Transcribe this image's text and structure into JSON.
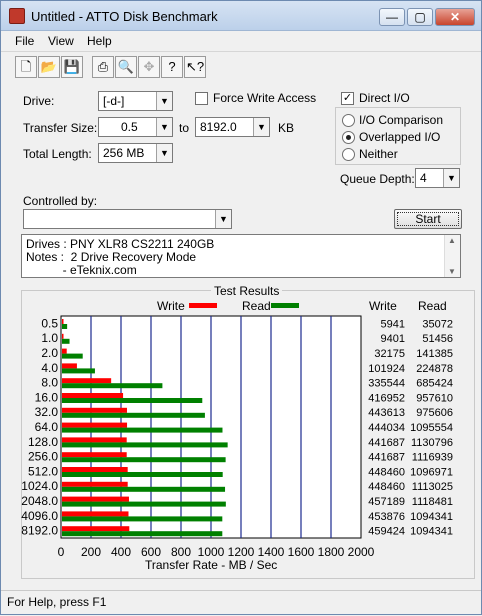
{
  "window": {
    "title": "Untitled - ATTO Disk Benchmark"
  },
  "menu": [
    "File",
    "View",
    "Help"
  ],
  "settings": {
    "drive_label": "Drive:",
    "drive_value": "[-d-]",
    "force_write_label": "Force Write Access",
    "force_write_checked": false,
    "direct_io_label": "Direct I/O",
    "direct_io_checked": true,
    "transfer_size_label": "Transfer Size:",
    "transfer_from": "0.5",
    "to_label": "to",
    "transfer_to": "8192.0",
    "kb_label": "KB",
    "total_length_label": "Total Length:",
    "total_length_value": "256 MB",
    "io_options": [
      "I/O Comparison",
      "Overlapped I/O",
      "Neither"
    ],
    "io_selected": 1,
    "queue_depth_label": "Queue Depth:",
    "queue_depth_value": "4",
    "controlled_by_label": "Controlled by:",
    "controlled_by_value": "",
    "start_label": "Start"
  },
  "notes": {
    "line1": "Drives : PNY XLR8 CS2211 240GB",
    "line2": "Notes :  2 Drive Recovery Mode",
    "line3": "           - eTeknix.com"
  },
  "results": {
    "title": "Test Results",
    "legend_write": "Write",
    "legend_read": "Read",
    "col_write": "Write",
    "col_read": "Read",
    "colors": {
      "write": "#ff0000",
      "read": "#008000"
    }
  },
  "chart_data": {
    "type": "bar",
    "orientation": "horizontal",
    "categories": [
      "0.5",
      "1.0",
      "2.0",
      "4.0",
      "8.0",
      "16.0",
      "32.0",
      "64.0",
      "128.0",
      "256.0",
      "512.0",
      "1024.0",
      "2048.0",
      "4096.0",
      "8192.0"
    ],
    "series": [
      {
        "name": "Write",
        "values": [
          5941,
          9401,
          32175,
          101924,
          335544,
          416952,
          443613,
          444034,
          441687,
          441687,
          448460,
          448460,
          457189,
          453876,
          459424
        ]
      },
      {
        "name": "Read",
        "values": [
          35072,
          51456,
          141385,
          224878,
          685424,
          957610,
          975606,
          1095554,
          1130796,
          1116939,
          1096971,
          1113025,
          1118481,
          1094341,
          1094341
        ]
      }
    ],
    "xlabel": "Transfer Rate - MB / Sec",
    "xlim": [
      0,
      2000
    ],
    "xticks": [
      "0",
      "200",
      "400",
      "600",
      "800",
      "1000",
      "1200",
      "1400",
      "1600",
      "1800",
      "2000"
    ]
  },
  "status": {
    "text": "For Help, press F1"
  }
}
